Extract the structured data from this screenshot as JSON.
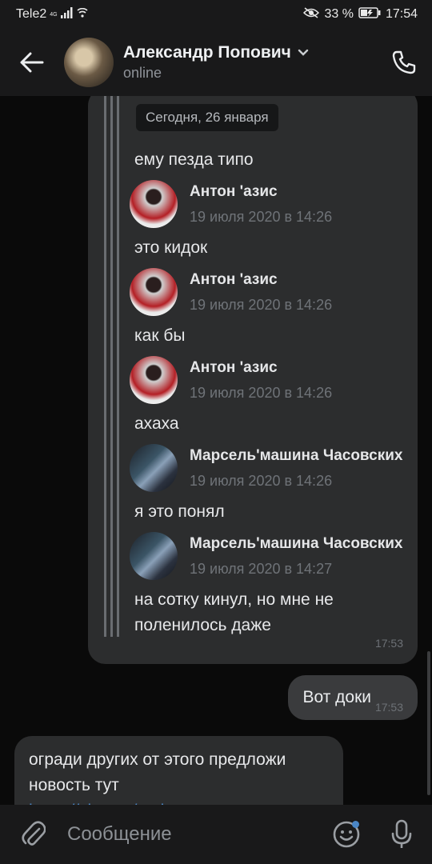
{
  "status_bar": {
    "carrier": "Tele2",
    "network": "4G",
    "battery": "33 %",
    "time": "17:54"
  },
  "header": {
    "name": "Александр Попович",
    "status": "online"
  },
  "chat": {
    "date_pill": "Сегодня, 26 января",
    "forwarded": [
      {
        "text": "ему пезда типо"
      },
      {
        "author": "Антон 'азис",
        "time": "19 июля 2020 в 14:26",
        "text": "это кидок"
      },
      {
        "author": "Антон 'азис",
        "time": "19 июля 2020 в 14:26",
        "text": "как бы"
      },
      {
        "author": "Антон 'азис",
        "time": "19 июля 2020 в 14:26",
        "text": "ахаха"
      },
      {
        "author": "Марсель'машина Часовских",
        "time": "19 июля 2020 в 14:26",
        "text": "я это понял"
      },
      {
        "author": "Марсель'машина Часовских",
        "time": "19 июля 2020 в 14:27",
        "text": "на сотку кинул, но мне не поленилось даже"
      }
    ],
    "forwarded_bubble_time": "17:53",
    "outgoing": {
      "text": "Вот доки",
      "time": "17:53"
    },
    "incoming2": {
      "line1": "огради других от этого предложи",
      "line2": "новость тут",
      "link": "https://vk.com/antiscamer и на"
    }
  },
  "composer": {
    "placeholder": "Сообщение"
  },
  "colors": {
    "accent": "#4a86c5",
    "background": "#0a0a0a",
    "bubble": "#2c2d2e",
    "bar": "#19191a"
  }
}
